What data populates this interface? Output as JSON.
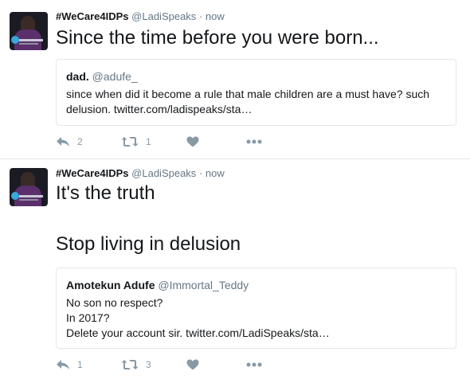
{
  "tweets": [
    {
      "name": "#WeCare4IDPs",
      "handle": "@LadiSpeaks",
      "separator": "·",
      "time": "now",
      "text": "Since the time before you were born...",
      "quote": {
        "name": "dad.",
        "handle": "@adufe_",
        "text": "since when did it become a rule that male children are a must have? such delusion. twitter.com/ladispeaks/sta…"
      },
      "replies": "2",
      "retweets": "1"
    },
    {
      "name": "#WeCare4IDPs",
      "handle": "@LadiSpeaks",
      "separator": "·",
      "time": "now",
      "text": "It's the truth\n\nStop living in delusion",
      "quote": {
        "name": "Amotekun Adufe",
        "handle": "@Immortal_Teddy",
        "text": "No son no respect?\nIn 2017?\nDelete your account sir. twitter.com/LadiSpeaks/sta…"
      },
      "replies": "1",
      "retweets": "3"
    }
  ],
  "icons": {
    "reply": "reply-icon",
    "retweet": "retweet-icon",
    "like": "heart-icon",
    "more": "more-dots-icon"
  },
  "colors": {
    "action_grey": "#8899a6",
    "border": "#e1e8ed",
    "handle_grey": "#657786"
  }
}
